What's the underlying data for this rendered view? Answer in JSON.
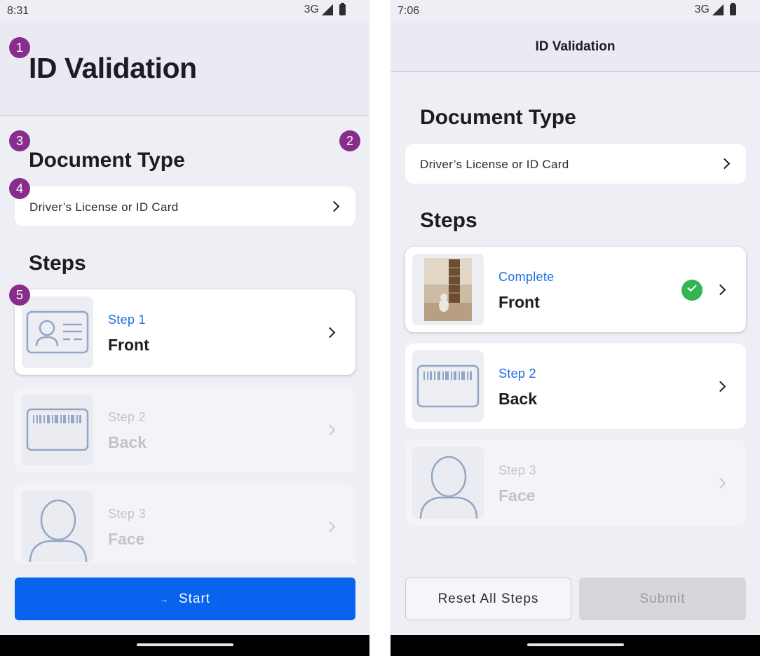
{
  "left": {
    "status": {
      "time": "8:31",
      "network": "3G"
    },
    "title": "ID Validation",
    "document_type": {
      "heading": "Document Type",
      "value": "Driver’s License or ID Card"
    },
    "steps_heading": "Steps",
    "steps": [
      {
        "label": "Step 1",
        "name": "Front",
        "state": "active"
      },
      {
        "label": "Step 2",
        "name": "Back",
        "state": "disabled"
      },
      {
        "label": "Step 3",
        "name": "Face",
        "state": "disabled"
      }
    ],
    "start_button": {
      "arrow": "→",
      "label": "Start"
    },
    "badges": [
      "1",
      "2",
      "3",
      "4",
      "5"
    ]
  },
  "right": {
    "status": {
      "time": "7:06",
      "network": "3G"
    },
    "title": "ID Validation",
    "document_type": {
      "heading": "Document Type",
      "value": "Driver’s License or ID Card"
    },
    "steps_heading": "Steps",
    "steps": [
      {
        "label": "Complete",
        "name": "Front",
        "state": "complete"
      },
      {
        "label": "Step 2",
        "name": "Back",
        "state": "active"
      },
      {
        "label": "Step 3",
        "name": "Face",
        "state": "disabled"
      }
    ],
    "reset_button": "Reset All Steps",
    "submit_button": "Submit"
  },
  "colors": {
    "accent": "#0a63ee",
    "step_label": "#1d6fdc",
    "badge": "#872e8c",
    "success": "#33b556"
  },
  "icons": [
    "id-card-icon",
    "barcode-card-icon",
    "person-icon",
    "chevron-right-icon",
    "check-circle-icon",
    "signal-icon",
    "battery-icon"
  ]
}
